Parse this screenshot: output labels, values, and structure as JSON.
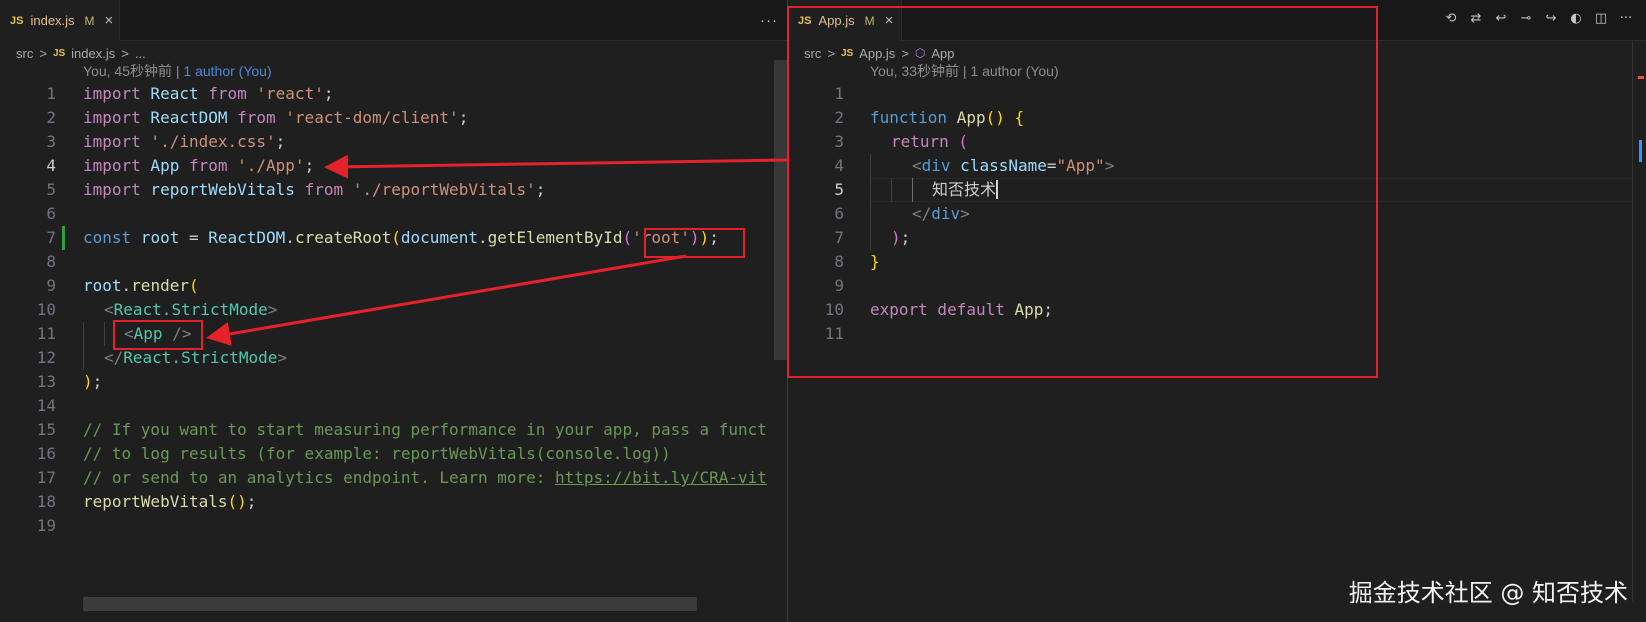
{
  "left": {
    "tab": {
      "badge": "JS",
      "name": "index.js",
      "modified": "M",
      "close": "×"
    },
    "more": "···",
    "breadcrumb": {
      "folder": "src",
      "sep": ">",
      "badge": "JS",
      "file": "index.js",
      "sep2": ">",
      "rest": "..."
    },
    "blame": {
      "text": "You, 45秒钟前 | ",
      "link": "1 author (You)"
    },
    "lines": [
      "1",
      "2",
      "3",
      "4",
      "5",
      "6",
      "7",
      "8",
      "9",
      "10",
      "11",
      "12",
      "13",
      "14",
      "15",
      "16",
      "17",
      "18",
      "19"
    ],
    "code": {
      "l1": [
        "import",
        " React ",
        "from",
        " 'react'",
        ";"
      ],
      "l2": [
        "import",
        " ReactDOM ",
        "from",
        " 'react-dom/client'",
        ";"
      ],
      "l3": [
        "import",
        " './index.css'",
        ";"
      ],
      "l4": [
        "import",
        " App ",
        "from",
        " './App'",
        ";"
      ],
      "l5": [
        "import",
        " reportWebVitals ",
        "from",
        " './reportWebVitals'",
        ";"
      ],
      "l7": [
        "const",
        " root ",
        "= ",
        "ReactDOM",
        ".",
        "createRoot",
        "(",
        "document",
        ".",
        "getElementById",
        "(",
        "'root'",
        ")",
        ")",
        ";"
      ],
      "l9": [
        "root",
        ".",
        "render",
        "("
      ],
      "l10": [
        "<",
        "React.StrictMode",
        ">"
      ],
      "l11": [
        "<",
        "App",
        " />"
      ],
      "l12": [
        "</",
        "React.StrictMode",
        ">"
      ],
      "l13": [
        ")",
        ";"
      ],
      "l15": "// If you want to start measuring performance in your app, pass a funct",
      "l16": "// to log results (for example: reportWebVitals(console.log))",
      "l17": [
        "// or send to an analytics endpoint. Learn more: ",
        "https://bit.ly/CRA-vit"
      ],
      "l18": [
        "reportWebVitals",
        "(",
        ")",
        ";"
      ]
    }
  },
  "right": {
    "tab": {
      "badge": "JS",
      "name": "App.js",
      "modified": "M",
      "close": "×"
    },
    "breadcrumb": {
      "folder": "src",
      "sep": ">",
      "badge": "JS",
      "file": "App.js",
      "sep2": ">",
      "symbol_icon": "⬡",
      "symbol": "App"
    },
    "blame": {
      "text": "You, 33秒钟前 | 1 author (You)"
    },
    "lines": [
      "1",
      "2",
      "3",
      "4",
      "5",
      "6",
      "7",
      "8",
      "9",
      "10",
      "11"
    ],
    "code": {
      "l2": [
        "function",
        " App",
        "(",
        ")",
        " {"
      ],
      "l3": [
        "return",
        " ("
      ],
      "l4": [
        "<",
        "div",
        " className",
        "=",
        "\"App\"",
        ">"
      ],
      "l5": "知否技术",
      "l6": [
        "</",
        "div",
        ">"
      ],
      "l7": [
        ")",
        ";"
      ],
      "l8": "}",
      "l10": [
        "export",
        " default",
        " App",
        ";"
      ]
    },
    "toolbar": [
      "history-icon",
      "compare-changes-icon",
      "go-back-icon",
      "commit-icon",
      "go-forward-icon",
      "gitlens-icon",
      "split-editor-icon",
      "more-actions-icon"
    ],
    "toolbar_glyphs": [
      "⟲",
      "⇄",
      "↩",
      "⊸",
      "↪",
      "◐",
      "◫",
      "···"
    ]
  },
  "watermark": "掘金技术社区 @ 知否技术",
  "colors": {
    "annotation_red": "#e5222a",
    "background": "#1f1f1f"
  }
}
